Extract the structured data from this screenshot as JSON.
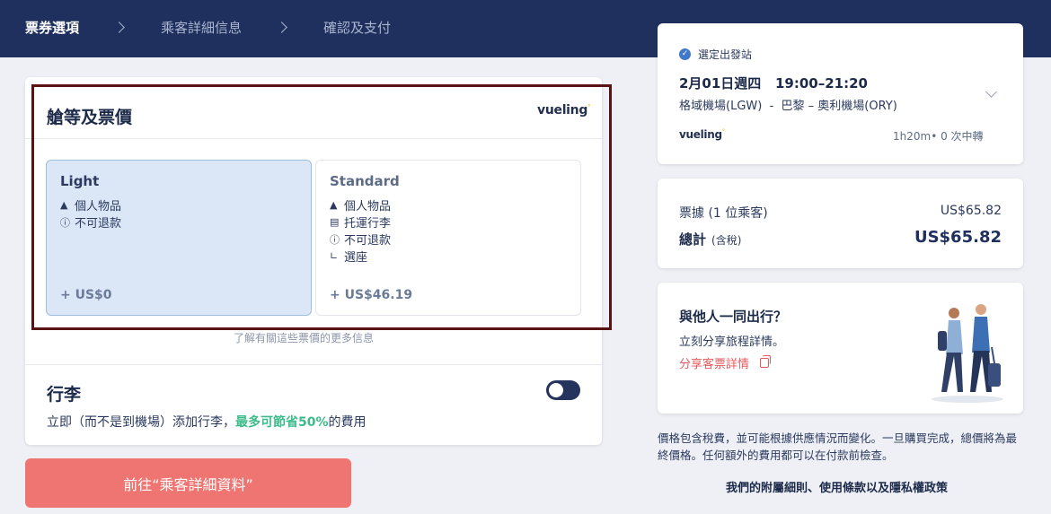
{
  "steps": [
    {
      "label": "票券選項",
      "active": true
    },
    {
      "label": "乘客詳細信息",
      "active": false
    },
    {
      "label": "確認及支付",
      "active": false
    }
  ],
  "cabin": {
    "title": "艙等及票價",
    "brand": "vueling",
    "fares": [
      {
        "name": "Light",
        "features": [
          "個人物品",
          "不可退款"
        ],
        "price": "+ US$0",
        "selected": true
      },
      {
        "name": "Standard",
        "features": [
          "個人物品",
          "托運行李",
          "不可退款",
          "選座"
        ],
        "price": "+ US$46.19",
        "selected": false
      }
    ],
    "learn_more": "了解有關這些票價的更多信息"
  },
  "baggage": {
    "title": "行李",
    "desc_prefix": "立即（而不是到機場）添加行李，",
    "desc_highlight": "最多可節省50%",
    "desc_suffix": "的費用",
    "toggle_on": false
  },
  "cta": {
    "label": "前往“乘客詳細資料”"
  },
  "flight": {
    "label": "選定出發站",
    "datetime": "2月01日週四   19:00–21:20",
    "route": "格域機場(LGW)  -  巴黎 – 奧利機場(ORY)",
    "brand": "vueling",
    "duration": "1h20m• 0 次中轉"
  },
  "price": {
    "ticket_label": "票據 (1 位乘客)",
    "ticket_value": "US$65.82",
    "total_label": "總計",
    "total_note": "(含稅)",
    "total_value": "US$65.82"
  },
  "share": {
    "title": "與他人一同出行？",
    "subtitle": "立刻分享旅程詳情。",
    "link": "分享客票詳情"
  },
  "disclaimer": "價格包含稅費，並可能根據供應情況而變化。一旦購買完成，總價將為最終價格。任何額外的費用都可以在付款前檢查。",
  "policy": "我們的附屬細則、使用條款以及隱私權政策",
  "colors": {
    "header": "#1f305e",
    "cta": "#ef7572",
    "selected_fare": "#dbe7f6",
    "save": "#3dbb8a",
    "link": "#e4595b",
    "highlight_border": "#5a1313"
  }
}
